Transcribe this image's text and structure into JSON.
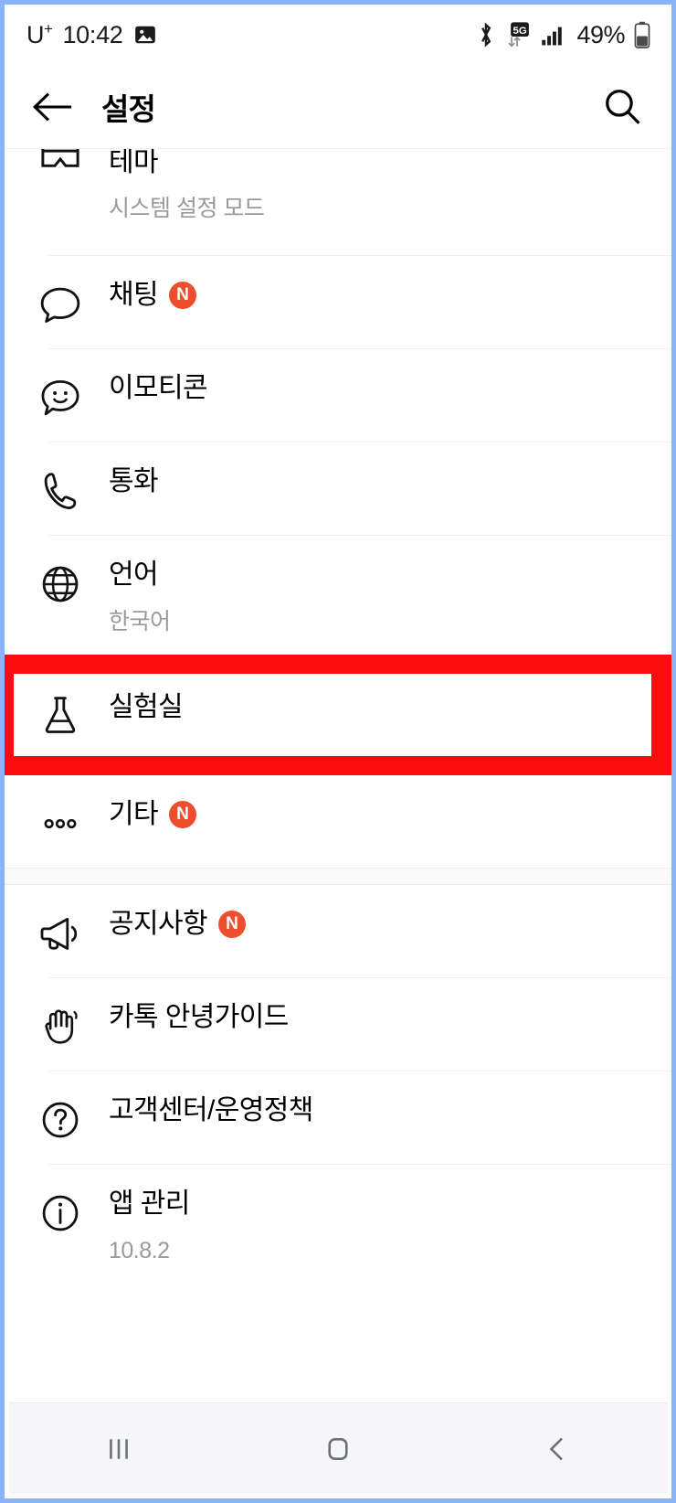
{
  "statusbar": {
    "carrier": "U",
    "carrier_sup": "+",
    "time": "10:42",
    "image_icon": "photo-icon",
    "bluetooth_icon": "bluetooth-icon",
    "network_label": "5G",
    "signal_icon": "signal-bars-icon",
    "battery_percent": "49%",
    "battery_icon": "battery-icon"
  },
  "appbar": {
    "back_icon": "back-arrow-icon",
    "title": "설정",
    "search_icon": "search-icon"
  },
  "accent": {
    "badge_orange": "#ee4e2e",
    "highlight_red": "#fc0d0d",
    "frame_blue": "#8ab4f8"
  },
  "list": {
    "sections": [
      {
        "items": [
          {
            "icon": "theme-icon",
            "label": "테마",
            "sub": "시스템 설정 모드",
            "badge": ""
          },
          {
            "icon": "chat-bubble-icon",
            "label": "채팅",
            "sub": "",
            "badge": "N"
          },
          {
            "icon": "emoticon-icon",
            "label": "이모티콘",
            "sub": "",
            "badge": ""
          },
          {
            "icon": "phone-icon",
            "label": "통화",
            "sub": "",
            "badge": ""
          },
          {
            "icon": "globe-icon",
            "label": "언어",
            "sub": "한국어",
            "badge": ""
          },
          {
            "icon": "flask-icon",
            "label": "실험실",
            "sub": "",
            "badge": "",
            "highlighted": true
          },
          {
            "icon": "more-dots-icon",
            "label": "기타",
            "sub": "",
            "badge": "N"
          }
        ]
      },
      {
        "items": [
          {
            "icon": "megaphone-icon",
            "label": "공지사항",
            "sub": "",
            "badge": "N"
          },
          {
            "icon": "wave-hand-icon",
            "label": "카톡 안녕가이드",
            "sub": "",
            "badge": ""
          },
          {
            "icon": "question-icon",
            "label": "고객센터/운영정책",
            "sub": "",
            "badge": ""
          },
          {
            "icon": "info-icon",
            "label": "앱 관리",
            "sub": "10.8.2",
            "badge": ""
          }
        ]
      }
    ]
  },
  "navbar": {
    "recents_label": "recents-icon",
    "home_label": "home-icon",
    "back_label": "back-icon"
  }
}
